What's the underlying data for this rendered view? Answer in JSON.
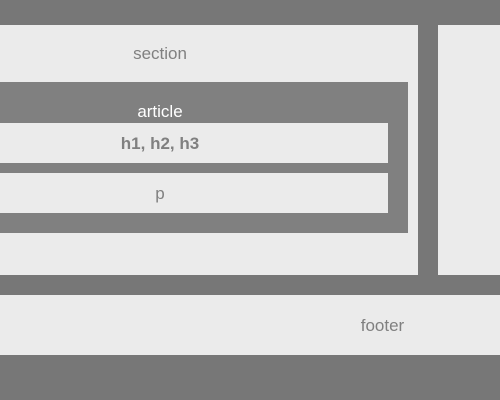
{
  "diagram": {
    "section_label": "section",
    "article_label": "article",
    "heading_label": "h1, h2, h3",
    "paragraph_label": "p",
    "footer_label": "footer"
  },
  "colors": {
    "background": "#777777",
    "light_box": "#ebebeb",
    "article_box": "#808080",
    "label_text": "#808080",
    "article_text": "#ffffff"
  }
}
